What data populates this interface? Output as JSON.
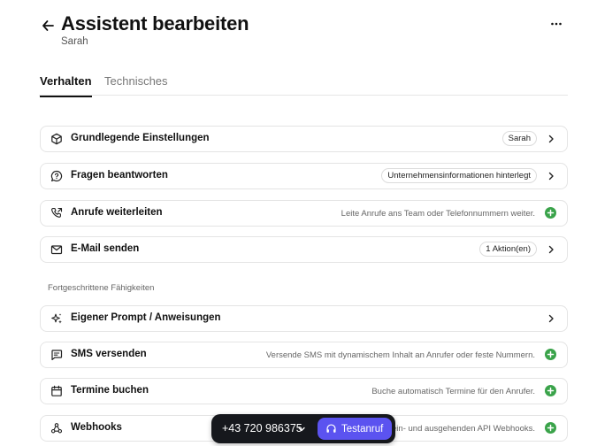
{
  "header": {
    "title": "Assistent bearbeiten",
    "subtitle": "Sarah"
  },
  "tabs": [
    {
      "label": "Verhalten",
      "active": true
    },
    {
      "label": "Technisches",
      "active": false
    }
  ],
  "rows": [
    {
      "label": "Grundlegende Einstellungen",
      "badge": "Sarah",
      "icon": "cube-icon",
      "action": "chevron"
    },
    {
      "label": "Fragen beantworten",
      "badge": "Unternehmensinformationen hinterlegt",
      "icon": "chat-question-icon",
      "action": "chevron"
    },
    {
      "label": "Anrufe weiterleiten",
      "description": "Leite Anrufe ans Team oder Telefonnummern weiter.",
      "icon": "phone-forward-icon",
      "action": "add"
    },
    {
      "label": "E-Mail senden",
      "badge": "1 Aktion(en)",
      "icon": "mail-icon",
      "action": "chevron"
    }
  ],
  "advanced": {
    "section_label": "Fortgeschrittene Fähigkeiten",
    "rows": [
      {
        "label": "Eigener Prompt / Anweisungen",
        "icon": "sparkle-icon",
        "action": "chevron"
      },
      {
        "label": "SMS versenden",
        "description": "Versende SMS mit dynamischem Inhalt an Anrufer oder feste Nummern.",
        "icon": "message-icon",
        "action": "add"
      },
      {
        "label": "Termine buchen",
        "description": "Buche automatisch Termine für den Anrufer.",
        "icon": "calendar-icon",
        "action": "add"
      },
      {
        "label": "Webhooks",
        "description": "ein- und ausgehenden API Webhooks.",
        "icon": "webhook-icon",
        "action": "add"
      }
    ]
  },
  "callbar": {
    "phone_number": "+43 720 986375",
    "test_button_label": "Testanruf"
  },
  "colors": {
    "accent": "#5b53f0",
    "add": "#3aa34a",
    "callbar_bg": "#16181d"
  }
}
